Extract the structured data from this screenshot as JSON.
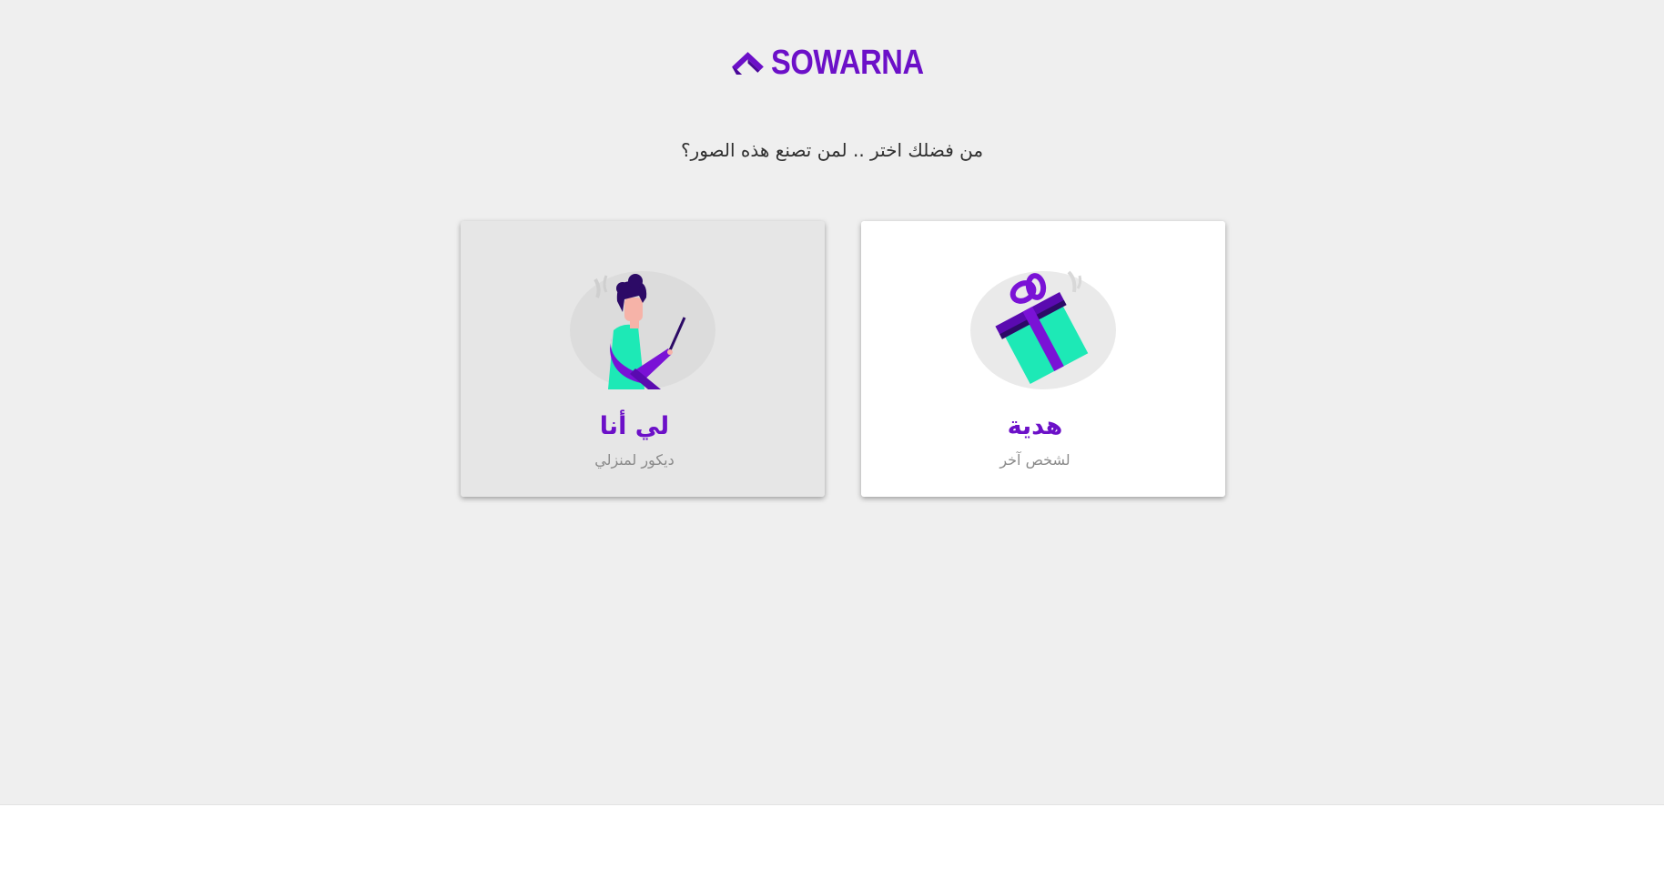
{
  "brand": {
    "name": "SOWARNA",
    "accent_color": "#6c10c8",
    "icon": "roof-logo-icon"
  },
  "prompt": {
    "question": "من فضلك اختر .. لمن تصنع هذه الصور؟"
  },
  "options": [
    {
      "title": "لي أنا",
      "subtitle": "ديكور لمنزلي",
      "icon": "person-with-pen-illustration",
      "selected": true
    },
    {
      "title": "هدية",
      "subtitle": "لشخص آخر",
      "icon": "gift-box-illustration",
      "selected": false
    }
  ],
  "colors": {
    "page_background": "#efefef",
    "card_background": "#ffffff",
    "selected_card_background": "#e6e6e6",
    "illustration_teal": "#1de9b6",
    "illustration_purple": "#7a12d6"
  }
}
